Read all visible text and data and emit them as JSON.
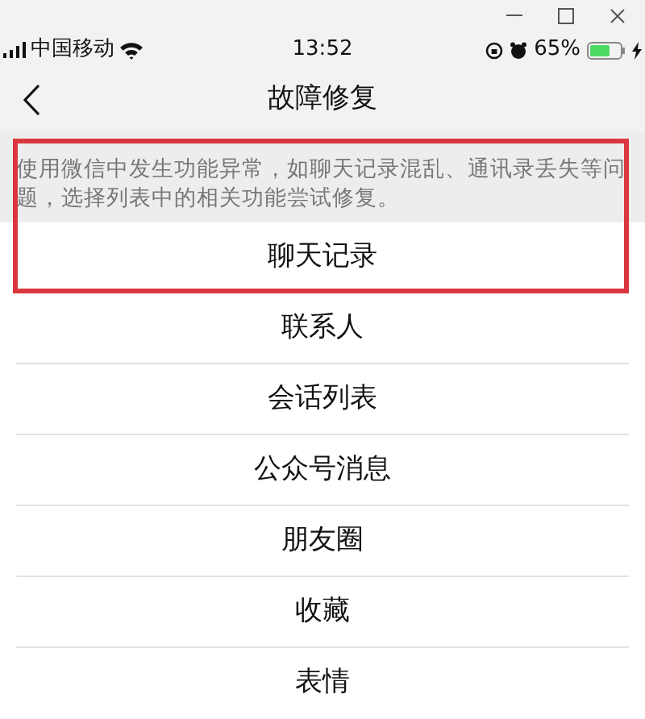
{
  "status_bar": {
    "carrier": "中国移动",
    "time": "13:52",
    "battery": "65%"
  },
  "nav": {
    "title": "故障修复"
  },
  "description": {
    "text": "使用微信中发生功能异常，如聊天记录混乱、通讯录丢失等问题，选择列表中的相关功能尝试修复。"
  },
  "highlight_box": true,
  "items": [
    {
      "label": "聊天记录"
    },
    {
      "label": "联系人"
    },
    {
      "label": "会话列表"
    },
    {
      "label": "公众号消息"
    },
    {
      "label": "朋友圈"
    },
    {
      "label": "收藏"
    },
    {
      "label": "表情"
    }
  ]
}
